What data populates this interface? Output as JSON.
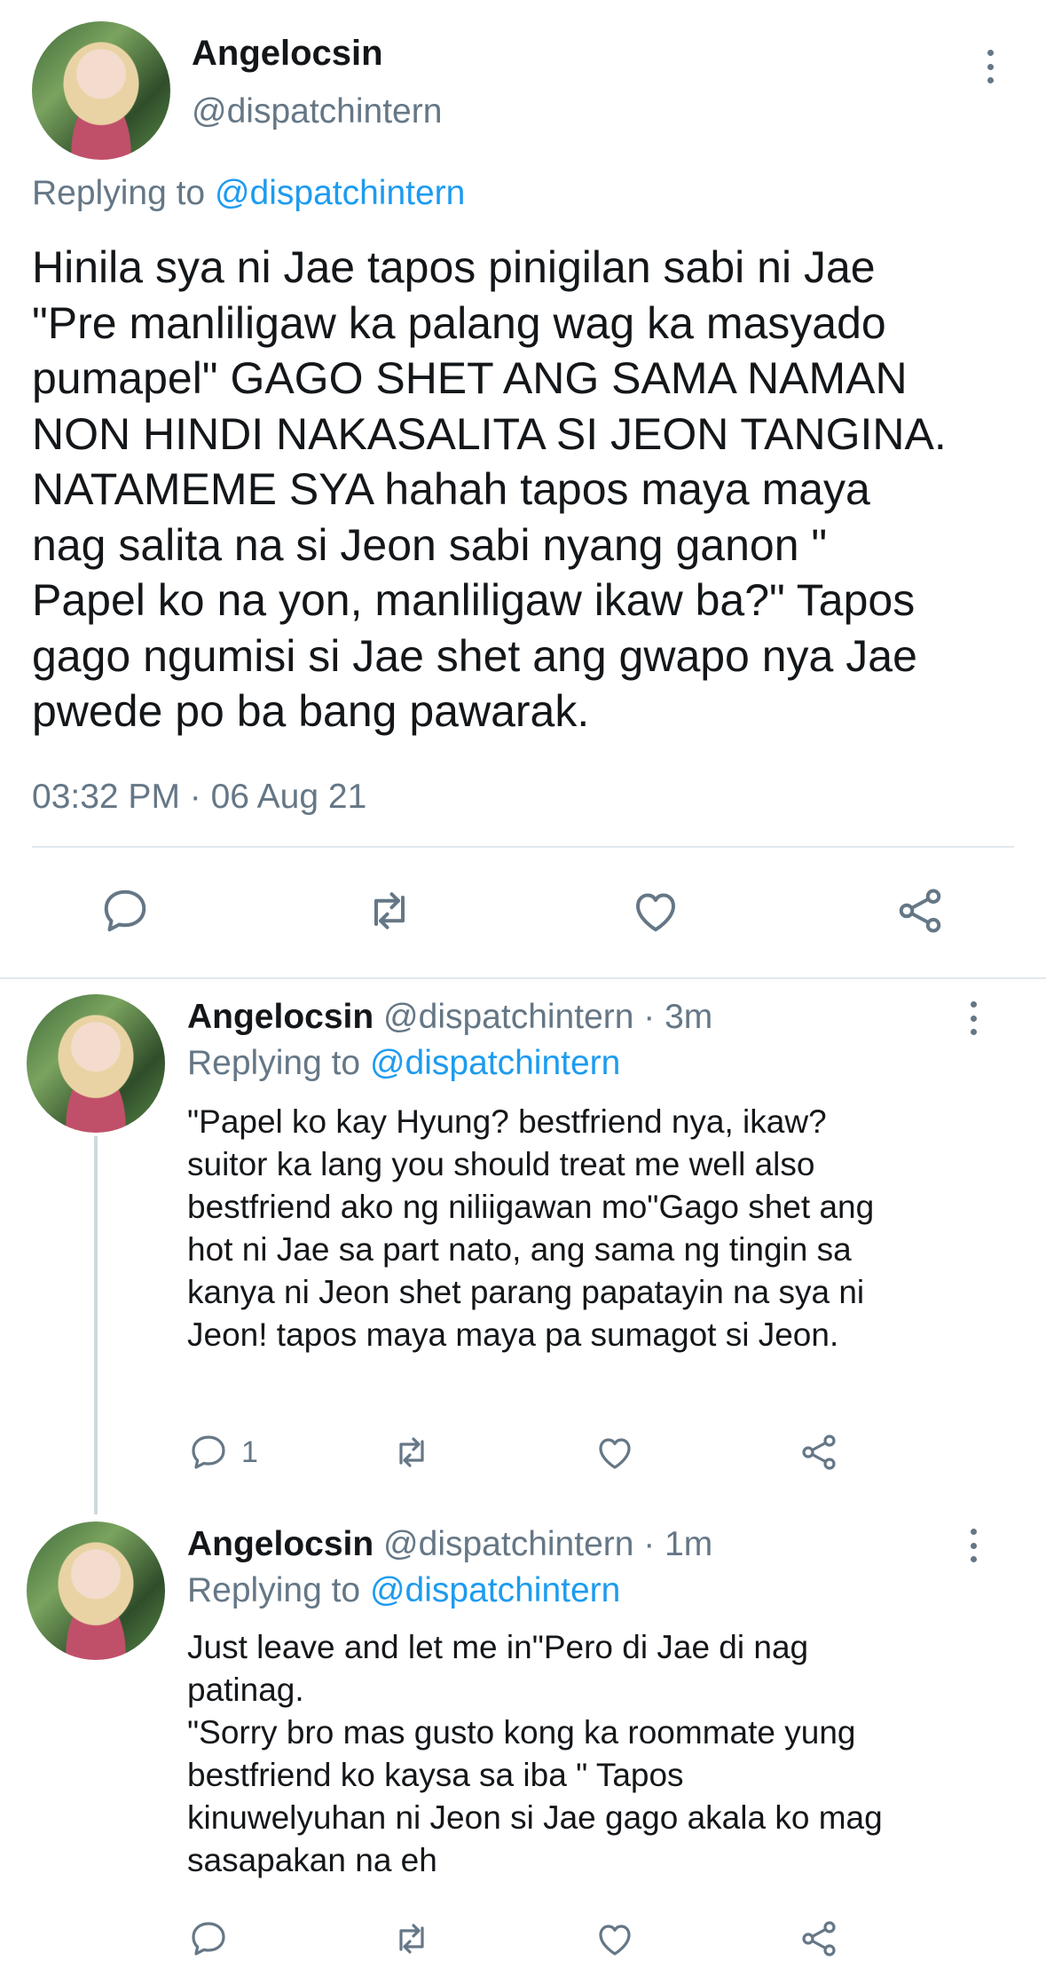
{
  "main_tweet": {
    "display_name": "Angelocsin",
    "handle": "@dispatchintern",
    "replying_prefix": "Replying to ",
    "replying_to": "@dispatchintern",
    "text_lines": [
      "Hinila sya ni Jae tapos pinigilan sabi ni Jae",
      "\"Pre manliligaw ka palang wag ka masyado",
      "pumapel\" GAGO SHET ANG SAMA NAMAN",
      "NON HINDI NAKASALITA SI JEON TANGINA.",
      "NATAMEME SYA hahah tapos maya maya",
      "nag salita na si Jeon sabi nyang ganon \"",
      "Papel ko na yon, manliligaw ikaw ba?\" Tapos",
      "gago ngumisi si Jae shet ang gwapo nya Jae",
      "pwede po ba bang pawarak."
    ],
    "timestamp": "03:32 PM · 06 Aug 21"
  },
  "replies": [
    {
      "display_name": "Angelocsin",
      "handle_time": "@dispatchintern · 3m",
      "replying_prefix": "Replying to ",
      "replying_to": "@dispatchintern",
      "text_lines": [
        "\"Papel ko kay Hyung? bestfriend nya, ikaw?",
        "suitor ka lang you should treat me well also",
        "bestfriend ako ng niliigawan mo\"Gago shet ang",
        "hot ni Jae sa part nato, ang sama ng tingin sa",
        "kanya ni Jeon shet parang papatayin na sya ni",
        "Jeon! tapos maya maya pa sumagot si Jeon."
      ],
      "reply_count": "1"
    },
    {
      "display_name": "Angelocsin",
      "handle_time": "@dispatchintern · 1m",
      "replying_prefix": "Replying to ",
      "replying_to": "@dispatchintern",
      "text_lines": [
        "Just leave and let me in\"Pero di Jae di nag",
        "patinag.",
        "\"Sorry bro mas gusto kong ka roommate yung",
        "bestfriend ko kaysa sa iba \" Tapos",
        "kinuwelyuhan ni Jeon si Jae gago akala ko mag",
        "sasapakan na eh"
      ],
      "reply_count": ""
    }
  ],
  "icons": {
    "reply": "reply-icon",
    "retweet": "retweet-icon",
    "like": "heart-icon",
    "share": "share-icon",
    "more": "more-vertical-icon"
  },
  "colors": {
    "link": "#1d9bf0",
    "muted": "#657786",
    "text": "#14171a",
    "divider": "#e1e8ed"
  }
}
